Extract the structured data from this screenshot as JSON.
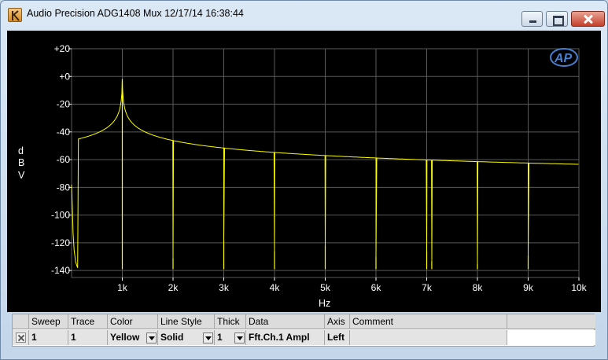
{
  "window": {
    "title": "Audio Precision  ADG1408 Mux  12/17/14 16:38:44"
  },
  "icons": {
    "app": "app-logo-icon",
    "minimize": "minimize-icon",
    "maximize": "maximize-icon",
    "close": "close-icon",
    "brand": "ap-logo-icon",
    "checkbox": "checkbox-icon",
    "dropdown": "chevron-down-icon"
  },
  "colors": {
    "trace": "#ffff00",
    "grid": "#5a5a5a",
    "background": "#000000"
  },
  "brand_logo_text": "AP",
  "chart_data": {
    "type": "line",
    "xlabel": "Hz",
    "ylabel": "dBV",
    "ylabel_chars": [
      "d",
      "B",
      "V"
    ],
    "xlim": [
      0,
      10000
    ],
    "ylim": [
      -145,
      20
    ],
    "x_ticks": [
      {
        "value": 1000,
        "label": "1k"
      },
      {
        "value": 2000,
        "label": "2k"
      },
      {
        "value": 3000,
        "label": "3k"
      },
      {
        "value": 4000,
        "label": "4k"
      },
      {
        "value": 5000,
        "label": "5k"
      },
      {
        "value": 6000,
        "label": "6k"
      },
      {
        "value": 7000,
        "label": "7k"
      },
      {
        "value": 8000,
        "label": "8k"
      },
      {
        "value": 9000,
        "label": "9k"
      },
      {
        "value": 10000,
        "label": "10k"
      }
    ],
    "y_ticks": [
      {
        "value": 20,
        "label": "+20"
      },
      {
        "value": 0,
        "label": "+0"
      },
      {
        "value": -20,
        "label": "-20"
      },
      {
        "value": -40,
        "label": "-40"
      },
      {
        "value": -60,
        "label": "-60"
      },
      {
        "value": -80,
        "label": "-80"
      },
      {
        "value": -100,
        "label": "-100"
      },
      {
        "value": -120,
        "label": "-120"
      },
      {
        "value": -140,
        "label": "-140"
      }
    ],
    "grid": true,
    "noise_floor": -139,
    "low_freq_rise": [
      {
        "x": 0,
        "y": -78
      },
      {
        "x": 15,
        "y": -95
      },
      {
        "x": 30,
        "y": -113
      },
      {
        "x": 50,
        "y": -125
      },
      {
        "x": 80,
        "y": -134
      },
      {
        "x": 120,
        "y": -138
      }
    ],
    "series": [
      {
        "trace": "1",
        "peaks": [
          {
            "x": 1000,
            "y": -2
          },
          {
            "x": 2000,
            "y": -131
          },
          {
            "x": 3000,
            "y": -118
          },
          {
            "x": 4000,
            "y": -126
          },
          {
            "x": 5000,
            "y": -122
          },
          {
            "x": 6000,
            "y": -130
          },
          {
            "x": 7000,
            "y": -126
          },
          {
            "x": 7100,
            "y": -133
          },
          {
            "x": 8000,
            "y": -135
          },
          {
            "x": 9000,
            "y": -129
          }
        ]
      }
    ]
  },
  "trace_table": {
    "headers": [
      "",
      "Sweep",
      "Trace",
      "Color",
      "Line Style",
      "Thick",
      "Data",
      "Axis",
      "Comment",
      ""
    ],
    "rows": [
      {
        "sweep": "1",
        "trace": "1",
        "color": "Yellow",
        "line_style": "Solid",
        "thick": "1",
        "data": "Fft.Ch.1 Ampl",
        "axis": "Left",
        "comment": ""
      }
    ]
  }
}
